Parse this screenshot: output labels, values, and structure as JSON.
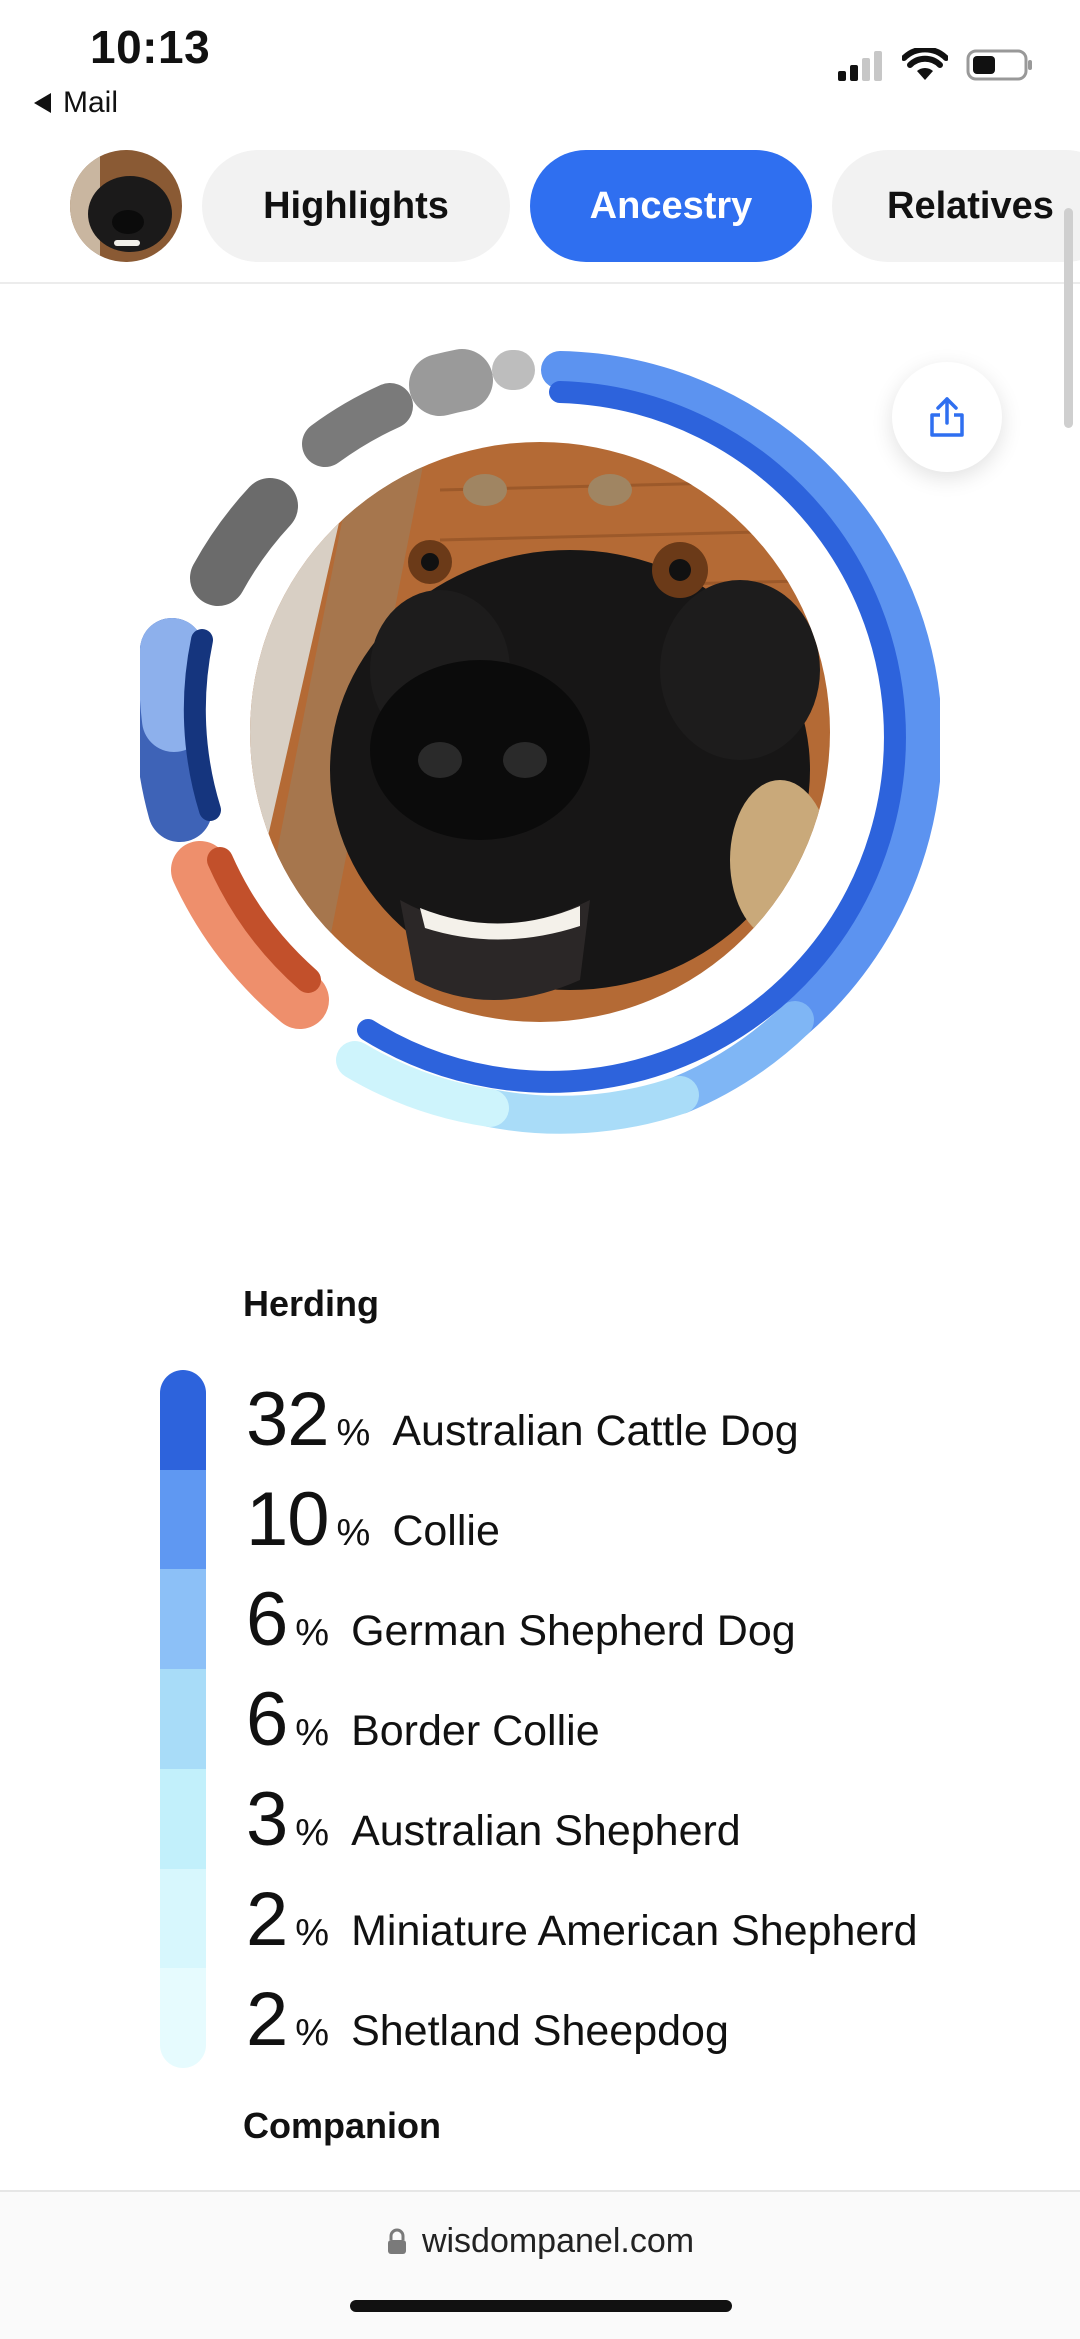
{
  "status_bar": {
    "time": "10:13",
    "back_label": "Mail"
  },
  "tabs": [
    {
      "label": "Highlights",
      "active": false
    },
    {
      "label": "Ancestry",
      "active": true
    },
    {
      "label": "Relatives",
      "active": false
    }
  ],
  "colors": {
    "accent": "#2f6ff0",
    "tab_bg": "#f2f2f2"
  },
  "ancestry": {
    "group_heading": "Herding",
    "breeds": [
      {
        "pct": "32",
        "symbol": "%",
        "name": "Australian Cattle Dog",
        "color": "#2d63dc"
      },
      {
        "pct": "10",
        "symbol": "%",
        "name": "Collie",
        "color": "#5f98f2"
      },
      {
        "pct": "6",
        "symbol": "%",
        "name": "German Shepherd Dog",
        "color": "#8cc0f7"
      },
      {
        "pct": "6",
        "symbol": "%",
        "name": "Border Collie",
        "color": "#a8dcf8"
      },
      {
        "pct": "3",
        "symbol": "%",
        "name": "Australian Shepherd",
        "color": "#c2f0fb"
      },
      {
        "pct": "2",
        "symbol": "%",
        "name": "Miniature American Shepherd",
        "color": "#d7f7fd"
      },
      {
        "pct": "2",
        "symbol": "%",
        "name": "Shetland Sheepdog",
        "color": "#e6fbfe"
      }
    ],
    "next_heading": "Companion"
  },
  "browser": {
    "url": "wisdompanel.com"
  },
  "icons": [
    "back-arrow-icon",
    "signal-icon",
    "wifi-icon",
    "battery-icon",
    "share-icon",
    "lock-icon"
  ]
}
